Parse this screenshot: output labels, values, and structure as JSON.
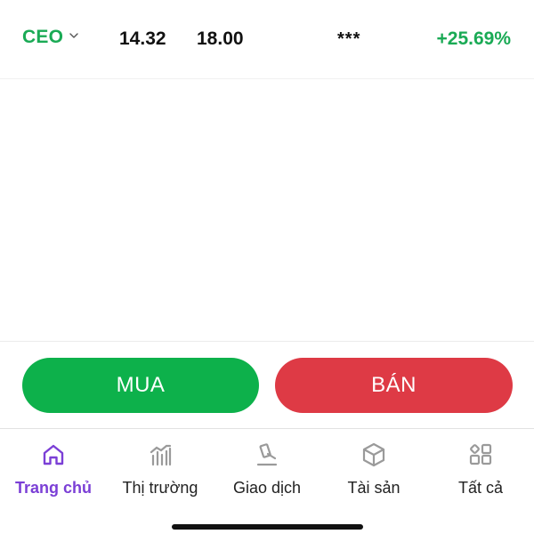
{
  "quote": {
    "symbol": "CEO",
    "price_1": "14.32",
    "price_2": "18.00",
    "masked": "***",
    "change": "+25.69%"
  },
  "actions": {
    "buy_label": "MUA",
    "sell_label": "BÁN"
  },
  "nav": {
    "items": [
      {
        "label": "Trang chủ",
        "icon": "home-icon",
        "active": true
      },
      {
        "label": "Thị trường",
        "icon": "market-chart-icon",
        "active": false
      },
      {
        "label": "Giao dịch",
        "icon": "gavel-icon",
        "active": false
      },
      {
        "label": "Tài sản",
        "icon": "cube-icon",
        "active": false
      },
      {
        "label": "Tất cả",
        "icon": "grid-icon",
        "active": false
      }
    ]
  },
  "colors": {
    "up": "#1aaa55",
    "buy": "#0db14b",
    "sell": "#de3a45",
    "active_nav": "#7b3fd6",
    "inactive_icon": "#9a9a9a"
  }
}
